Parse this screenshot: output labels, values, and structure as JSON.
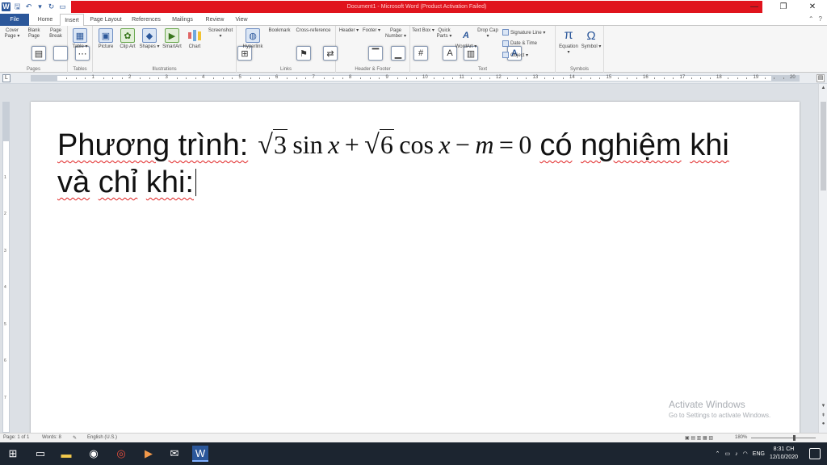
{
  "window": {
    "title": "Document1 - Microsoft Word (Product Activation Failed)",
    "min": "—",
    "max": "❐",
    "close": "✕"
  },
  "tabs": [
    "File",
    "Home",
    "Insert",
    "Page Layout",
    "References",
    "Mailings",
    "Review",
    "View"
  ],
  "ribbon": {
    "groups": {
      "pages": "Pages",
      "tables": "Tables",
      "illustrations": "Illustrations",
      "links": "Links",
      "header_footer": "Header & Footer",
      "text": "Text",
      "symbols": "Symbols"
    },
    "buttons": {
      "cover_page": "Cover Page ▾",
      "blank_page": "Blank Page",
      "page_break": "Page Break",
      "table": "Table ▾",
      "picture": "Picture",
      "clip_art": "Clip Art",
      "shapes": "Shapes ▾",
      "smartart": "SmartArt",
      "chart": "Chart",
      "screenshot": "Screenshot ▾",
      "hyperlink": "Hyperlink",
      "bookmark": "Bookmark",
      "cross_reference": "Cross-reference",
      "header": "Header ▾",
      "footer": "Footer ▾",
      "page_number": "Page Number ▾",
      "text_box": "Text Box ▾",
      "quick_parts": "Quick Parts ▾",
      "wordart": "WordArt ▾",
      "drop_cap": "Drop Cap ▾",
      "signature_line": "Signature Line ▾",
      "date_time": "Date & Time",
      "object": "Object ▾",
      "equation": "Equation ▾",
      "symbol": "Symbol ▾"
    }
  },
  "ruler": {
    "h_numbers": [
      "1",
      "2",
      "3",
      "4",
      "5",
      "6",
      "7",
      "8",
      "9",
      "10",
      "11",
      "12",
      "13",
      "14",
      "15",
      "16",
      "17",
      "18",
      "19",
      "20"
    ],
    "v_numbers": [
      "1",
      "2",
      "3",
      "4",
      "5",
      "6",
      "7"
    ]
  },
  "document": {
    "line1_prefix": "Phương trình:",
    "line1_suffix_words": [
      "có",
      "nghiệm",
      "khi"
    ],
    "line2_words": [
      "và",
      "chỉ",
      "khi:"
    ],
    "equation": {
      "r1": "3",
      "f1": "sin",
      "v1": "x",
      "op1": "+",
      "r2": "6",
      "f2": "cos",
      "v2": "x",
      "op2": "−",
      "m": "m",
      "eq": "=",
      "zero": "0"
    }
  },
  "watermark": {
    "line1": "Activate Windows",
    "line2": "Go to Settings to activate Windows."
  },
  "status": {
    "page": "Page: 1 of 1",
    "words": "Words: 8",
    "language": "English (U.S.)",
    "zoom": "180%"
  },
  "taskbar": {
    "language": "ENG",
    "time": "8:31 CH",
    "date": "12/10/2020"
  },
  "colors": {
    "word_blue": "#2b579a",
    "title_red": "#e0141d",
    "taskbar": "#1c2530"
  }
}
